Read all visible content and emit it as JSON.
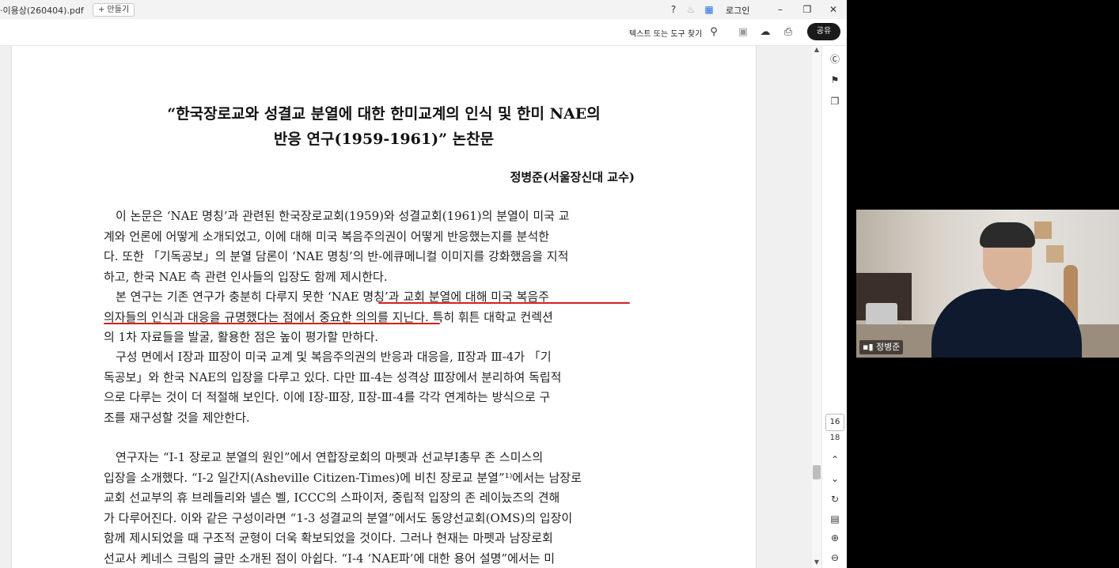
{
  "window": {
    "tab_title": "·이용상(260404).pdf",
    "new_button": "+ 만들기",
    "login": "로그인"
  },
  "toolbar": {
    "find_tool": "텍스트 또는 도구 찾기",
    "share": "공유"
  },
  "document": {
    "title_line1": "“한국장로교와 성결교 분열에 대한 한미교계의 인식 및 한미 NAE의",
    "title_line2": "반응 연구(1959-1961)” 논찬문",
    "author": "정병준(서울장신대 교수)",
    "para1": [
      "　이 논문은 ‘NAE 명칭’과 관련된 한국장로교회(1959)와 성결교회(1961)의 분열이 미국 교",
      "계와 언론에 어떻게 소개되었고, 이에 대해 미국 복음주의권이 어떻게 반응했는지를 분석한",
      "다. 또한 「기독공보」의 분열 담론이 ‘NAE 명칭’의 반-에큐메니컬 이미지를 강화했음을 지적",
      "하고, 한국 NAE 측 관련 인사들의 입장도 함께 제시한다."
    ],
    "para2": [
      "　본 연구는 기존 연구가 충분히 다루지 못한 ‘NAE 명칭’과 교회 분열에 대해 미국 복음주",
      "의자들의 인식과 대응을 규명했다는 점에서 중요한 의의를 지닌다. 특히 휘튼 대학교 컨렉션",
      "의 1차 자료들을 발굴, 활용한 점은 높이 평가할 만하다."
    ],
    "para3": [
      "　구성 면에서 Ⅰ장과 Ⅲ장이 미국 교계 및 복음주의권의 반응과 대응을, Ⅱ장과 Ⅲ-4가 「기",
      "독공보」와 한국 NAE의 입장을 다루고 있다. 다만 Ⅲ-4는 성격상 Ⅲ장에서 분리하여 독립적",
      "으로 다루는 것이 더 적절해 보인다. 이에 Ⅰ장-Ⅲ장, Ⅱ장-Ⅲ-4를 각각 연계하는 방식으로 구",
      "조를 재구성할 것을 제안한다."
    ],
    "para4": [
      "　연구자는 “Ⅰ-1 장로교 분열의 원인”에서 연합장로회의 마펫과 선교부Ⅰ총무 존 스미스의",
      "입장을 소개했다. “I-2 일간지(Asheville Citizen-Times)에 비친 장로교 분열”¹⁾에서는 남장로",
      "교회 선교부의 휴 브레들리와 넬슨 벨, ICCC의 스파이저, 중립적 입장의 존 레이늤즈의 견해",
      "가 다루어진다. 이와 같은 구성이라면 “1-3 성결교의 분열”에서도 동양선교회(OMS)의 입장이",
      "함께 제시되었을 때 구조적 균형이 더욱 확보되었을 것이다. 그러나 현재는 마펫과 남장로회",
      "선교사 케네스 크림의 글만 소개된 점이 아쉽다. “Ⅰ-4 ‘NAE파’에 대한 용어 설명”에서는 미"
    ]
  },
  "navigation": {
    "current_page": "16",
    "total_pages": "18"
  },
  "webcam": {
    "participant_name": "정병준"
  },
  "icons": [
    "help-icon",
    "bell-icon",
    "apps-icon",
    "minimize-icon",
    "maximize-icon",
    "close-icon",
    "search-icon",
    "save-icon",
    "upload-icon",
    "print-icon",
    "comment-icon",
    "bookmark-icon",
    "copy-icon",
    "page-up-icon",
    "page-down-icon",
    "refresh-icon",
    "page-info-icon",
    "zoom-in-icon",
    "zoom-out-icon",
    "signal-icon"
  ],
  "colors": {
    "annotation_underline": "#d61f1f",
    "share_button": "#1a1a1a"
  }
}
